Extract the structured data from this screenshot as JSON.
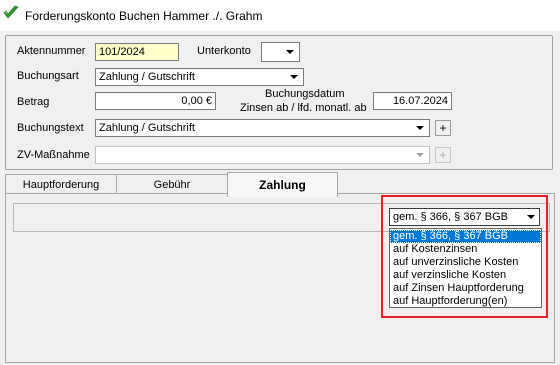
{
  "window": {
    "title": "Forderungskonto Buchen Hammer ./. Grahm",
    "icon": "green-check-icon"
  },
  "form": {
    "aktennummer_label": "Aktennummer",
    "aktennummer_value": "101/2024",
    "unterkonto_label": "Unterkonto",
    "unterkonto_value": "",
    "buchungsart_label": "Buchungsart",
    "buchungsart_value": "Zahlung / Gutschrift",
    "betrag_label": "Betrag",
    "betrag_value": "0,00 €",
    "buchungsdatum_label_line1": "Buchungsdatum",
    "buchungsdatum_label_line2": "Zinsen ab / lfd. monatl. ab",
    "buchungsdatum_value": "16.07.2024",
    "buchungstext_label": "Buchungstext",
    "buchungstext_value": "Zahlung / Gutschrift",
    "zv_label": "ZV-Maßnahme",
    "zv_value": "",
    "plus_label": "+"
  },
  "tabs": [
    {
      "label": "Hauptforderung",
      "active": false
    },
    {
      "label": "Gebühr",
      "active": false
    },
    {
      "label": "Zahlung",
      "active": true
    }
  ],
  "payment": {
    "selected": "gem. § 366, § 367 BGB",
    "options": [
      "gem. § 366, § 367 BGB",
      "auf Kostenzinsen",
      "auf unverzinsliche Kosten",
      "auf verzinsliche Kosten",
      "auf Zinsen Hauptforderung",
      "auf Hauptforderung(en)"
    ],
    "highlight_color": "#e32222"
  }
}
